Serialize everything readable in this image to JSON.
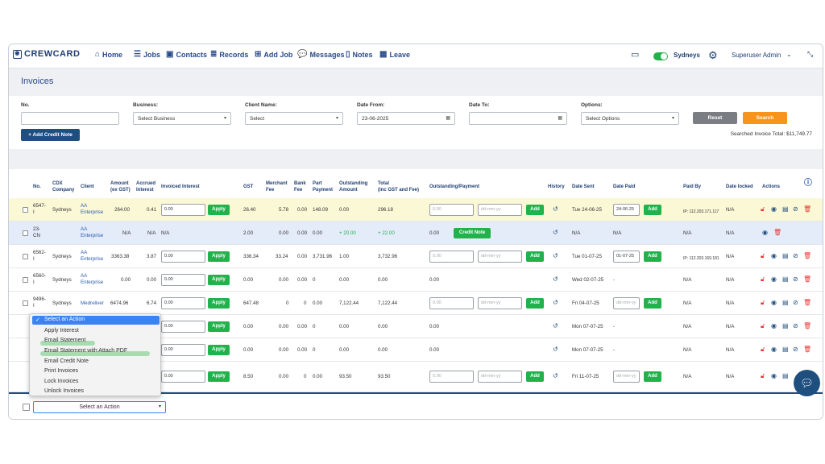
{
  "nav": {
    "logo": "CREWCARD",
    "items": [
      "Home",
      "Jobs",
      "Contacts",
      "Records",
      "Add Job",
      "Messages",
      "Notes",
      "Leave"
    ],
    "location": "Sydneys",
    "user": "Superuser Admin"
  },
  "page": {
    "title": "Invoices"
  },
  "filters": {
    "no_label": "No.",
    "business_label": "Business:",
    "business_value": "Select Business",
    "client_label": "Client Name:",
    "client_value": "Select",
    "date_from_label": "Date From:",
    "date_from_value": "23-06-2025",
    "date_to_label": "Date To:",
    "options_label": "Options:",
    "options_value": "Select Options",
    "reset": "Reset",
    "search": "Search",
    "add_credit_note": "+ Add Credit Note",
    "total_text": "Searched Invoice Total: $11,749.77"
  },
  "columns": {
    "no": "No.",
    "company": [
      "CDX",
      "Company"
    ],
    "client": "Client",
    "amount": [
      "Amount",
      "(ex GST)"
    ],
    "accrued": [
      "Accrued",
      "Interest"
    ],
    "invoiced": "Invoiced Interest",
    "gst": "GST",
    "merchant": [
      "Merchant",
      "Fee"
    ],
    "bank": [
      "Bank",
      "Fee"
    ],
    "part": [
      "Part",
      "Payment"
    ],
    "outstanding": [
      "Outstanding",
      "Amount"
    ],
    "total": [
      "Total",
      "(inc GST and Fee)"
    ],
    "outpay": "Outstanding/Payment",
    "history": "History",
    "date_sent": "Date Sent",
    "date_paid": "Date Paid",
    "paid_by": "Paid By",
    "date_locked": "Date locked",
    "actions": "Actions"
  },
  "labels": {
    "apply": "Apply",
    "add": "Add",
    "credit_note": "Credit Note",
    "date_ph": "dd-mm-yy",
    "amount_ph": "0.00"
  },
  "rows": [
    {
      "no": [
        "6547-",
        "I"
      ],
      "company": "Sydneys",
      "client": [
        "AA",
        "Enterprise"
      ],
      "amount": "264.00",
      "accrued": "0.41",
      "interest": "0.00",
      "gst": "26.40",
      "merchant": "5.78",
      "bank": "0.00",
      "part": "148.09",
      "outstanding": "0.00",
      "total": "296.18",
      "date_sent": "Tue 24-06-25",
      "date_paid": "24-06-25",
      "paid_by": "IP: 112.203.171.117",
      "locked": "N/A"
    },
    {
      "no": [
        "23-",
        "CN"
      ],
      "company": "",
      "client": [
        "AA",
        "Enterprise"
      ],
      "amount": "N/A",
      "accrued": "N/A",
      "interest": "N/A",
      "gst": "2.00",
      "merchant": "0.00",
      "bank": "0.00",
      "part": "0.00",
      "outstanding": "+ 20.00",
      "total": "+ 22.00",
      "op_value": "0.00",
      "date_sent": "N/A",
      "date_paid": "N/A",
      "paid_by": "N/A",
      "locked": "N/A"
    },
    {
      "no": [
        "6562-",
        "I"
      ],
      "company": "Sydneys",
      "client": [
        "AA",
        "Enterprise"
      ],
      "amount": "3363.38",
      "accrued": "3.87",
      "interest": "0.00",
      "gst": "336.34",
      "merchant": "33.24",
      "bank": "0.00",
      "part": "3,731.96",
      "outstanding": "1.00",
      "total": "3,732.96",
      "date_sent": "Tue 01-07-25",
      "date_paid": "01-07-25",
      "paid_by": "IP: 112.203.169.181",
      "locked": "N/A"
    },
    {
      "no": [
        "6560-",
        "I"
      ],
      "company": "Sydneys",
      "client": [
        "AA",
        "Enterprise"
      ],
      "amount": "0.00",
      "accrued": "0.00",
      "interest": "0.00",
      "gst": "0.00",
      "merchant": "0.00",
      "bank": "0.00",
      "part": "0",
      "outstanding": "0.00",
      "total": "0.00",
      "op_value": "0.00",
      "date_sent": "Wed 02-07-25",
      "date_paid": "-",
      "paid_by": "N/A",
      "locked": "N/A"
    },
    {
      "no": [
        "9496-",
        "I"
      ],
      "company": "Sydneys",
      "client": [
        "Medreliver"
      ],
      "amount": "6474.96",
      "accrued": "6.74",
      "interest": "0.00",
      "gst": "647.48",
      "merchant": "0",
      "bank": "0",
      "part": "0.00",
      "outstanding": "7,122.44",
      "total": "7,122.44",
      "date_sent": "Fri 04-07-25",
      "date_paid": "",
      "paid_by": "N/A",
      "locked": "N/A"
    },
    {
      "interest": "0.00",
      "gst": "0.00",
      "merchant": "0.00",
      "bank": "0.00",
      "part": "0",
      "outstanding": "0.00",
      "total": "0.00",
      "op_value": "0.00",
      "date_sent": "Mon 07-07-25",
      "date_paid": "-",
      "paid_by": "N/A",
      "locked": "N/A"
    },
    {
      "interest": "0.00",
      "gst": "0.00",
      "merchant": "0.00",
      "bank": "0.00",
      "part": "0",
      "outstanding": "0.00",
      "total": "0.00",
      "op_value": "0.00",
      "date_sent": "Mon 07-07-25",
      "date_paid": "-",
      "paid_by": "N/A",
      "locked": "N/A"
    },
    {
      "interest": "0.00",
      "gst": "8.50",
      "merchant": "0.00",
      "bank": "0",
      "part": "0.00",
      "outstanding": "93.50",
      "total": "93.50",
      "date_sent": "Fri 11-07-25",
      "date_paid": "",
      "paid_by": "N/A",
      "locked": "N/A"
    }
  ],
  "action_dropdown": {
    "options": [
      "Select an Action",
      "Apply Interest",
      "Email Statement",
      "Email Statement with Attach PDF",
      "Email Credit Note",
      "Print Invoices",
      "Lock Invoices",
      "Unlock Invoices"
    ],
    "selected": "Select an Action"
  },
  "colors": {
    "primary": "#1f4f7f",
    "green": "#22b24c",
    "orange": "#f7941d",
    "highlight_yellow": "#fbf8d6",
    "highlight_blue": "#e4ecfa"
  }
}
